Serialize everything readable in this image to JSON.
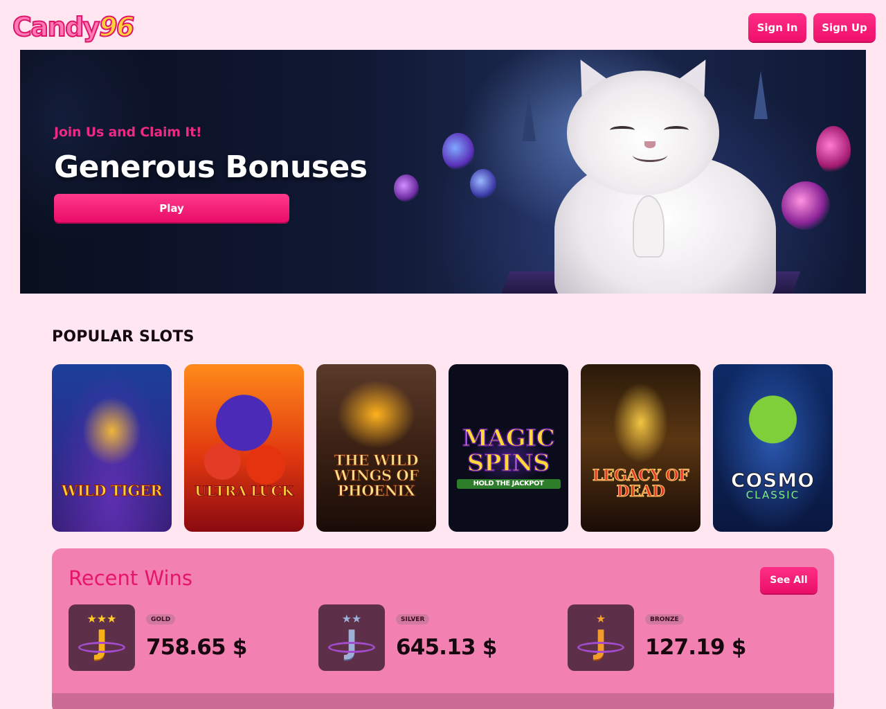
{
  "header": {
    "logo_word": "Candy",
    "logo_number": "96",
    "sign_in_label": "Sign In",
    "sign_up_label": "Sign Up"
  },
  "hero": {
    "kicker": "Join Us and Claim It!",
    "title": "Generous Bonuses",
    "play_label": "Play"
  },
  "popular_slots": {
    "title": "POPULAR SLOTS",
    "games": [
      {
        "name": "WILD TIGER"
      },
      {
        "name": "ULTRA LUCK"
      },
      {
        "name": "THE WILD WINGS OF PHOENIX"
      },
      {
        "name": "MAGIC SPINS",
        "tagline": "HOLD THE JACKPOT"
      },
      {
        "name": "LEGACY OF DEAD"
      },
      {
        "name": "COSMO",
        "tagline": "CLASSIC"
      }
    ]
  },
  "recent_wins": {
    "title": "Recent Wins",
    "see_all_label": "See All",
    "items": [
      {
        "tier": "GOLD",
        "amount": "758.65 $",
        "badge_letter": "J",
        "stars": "★★★"
      },
      {
        "tier": "SILVER",
        "amount": "645.13 $",
        "badge_letter": "J",
        "stars": "★★"
      },
      {
        "tier": "BRONZE",
        "amount": "127.19 $",
        "badge_letter": "J",
        "stars": "★"
      }
    ]
  },
  "colors": {
    "background": "#ffe6f1",
    "accent": "#ee0f6b",
    "wins_panel": "#f281b1"
  }
}
